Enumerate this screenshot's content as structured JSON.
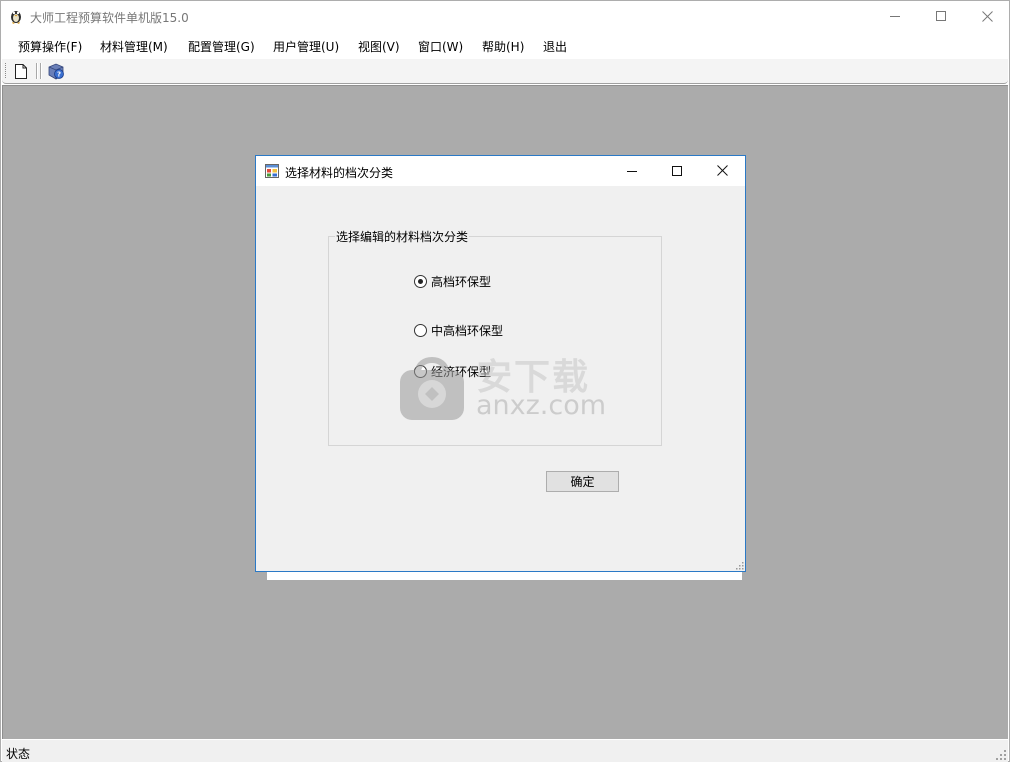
{
  "app": {
    "title": "大师工程预算软件单机版15.0"
  },
  "menu": {
    "items": [
      "预算操作(F)",
      "材料管理(M)",
      "配置管理(G)",
      "用户管理(U)",
      "视图(V)",
      "窗口(W)",
      "帮助(H)",
      "退出"
    ]
  },
  "toolbar": {
    "icons": [
      "new-document-icon",
      "help-icon"
    ]
  },
  "dialog": {
    "title": "选择材料的档次分类",
    "group_label": "选择编辑的材料档次分类",
    "options": [
      {
        "label": "高档环保型",
        "checked": true
      },
      {
        "label": "中高档环保型",
        "checked": false
      },
      {
        "label": "经济环保型",
        "checked": false
      }
    ],
    "ok_label": "确定"
  },
  "status": {
    "text": "状态"
  },
  "watermark": {
    "cn": "安下载",
    "en": "anxz.com"
  },
  "colors": {
    "mdi_background": "#ababab",
    "dialog_border": "#2b79c6",
    "dialog_body": "#f0f0f0"
  }
}
